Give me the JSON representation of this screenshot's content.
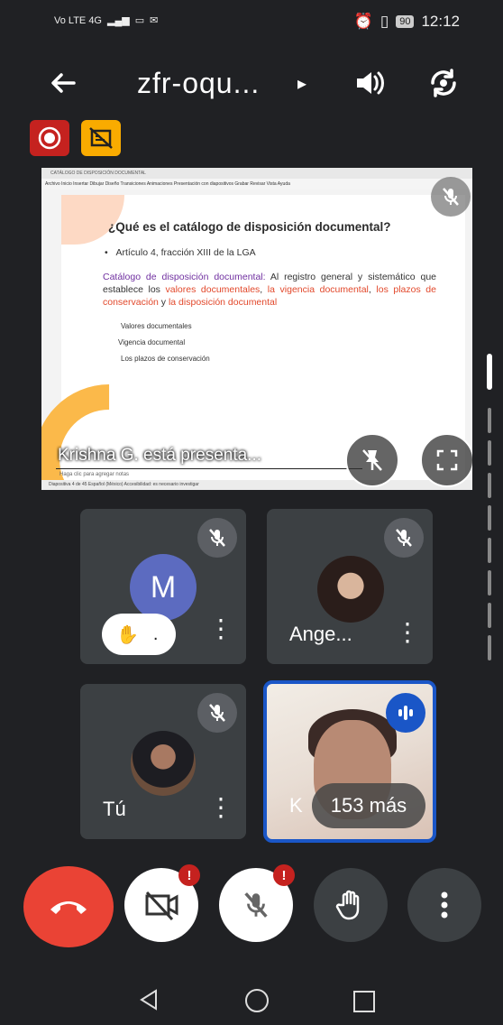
{
  "status_bar": {
    "left": "Vo LTE 4G",
    "battery": "90",
    "time": "12:12"
  },
  "header": {
    "title": "zfr-oqu...",
    "caret": "▸"
  },
  "presentation": {
    "ppt_title": "CATÁLOGO DE DISPOSICIÓN DOCUMENTAL",
    "ppt_menu": "Archivo   Inicio   Insertar   Dibujar   Diseño   Transiciones   Animaciones   Presentación con diapositivos   Grabar   Revisar   Vista   Ayuda",
    "slide_title": "¿Qué es el catálogo de disposición documental?",
    "bullet": "Artículo 4, fracción XIII de la LGA",
    "para_label": "Catálogo de disposición documental:",
    "para_plain1": " Al registro general y sistemático que establece los ",
    "para_red1": "valores documentales",
    "para_plain2": ", ",
    "para_red2": "la vigencia documental",
    "para_plain3": ", ",
    "para_red3": "los plazos de conservación",
    "para_plain4": " y ",
    "para_red4": "la disposición documental",
    "items": [
      "Valores documentales",
      "Vigencia documental",
      "Los plazos de conservación"
    ],
    "notes": "Haga clic para agregar notas",
    "status": "Diapositiva 4 de 45   Español (México)   Accesibilidad: es necesario investigar",
    "presenting_label": "Krishna G. está presenta..."
  },
  "tiles": {
    "m": {
      "initial": "M",
      "hand_dot": "."
    },
    "ange": {
      "name": "Ange..."
    },
    "tu": {
      "name": "Tú"
    },
    "krishna": {
      "name": "K",
      "more": "153 más"
    }
  },
  "colors": {
    "end_call": "#ea4335",
    "speaking": "#1a56c7",
    "alert": "#c5221f",
    "record": "#c5221f",
    "captions": "#f9ab00"
  }
}
